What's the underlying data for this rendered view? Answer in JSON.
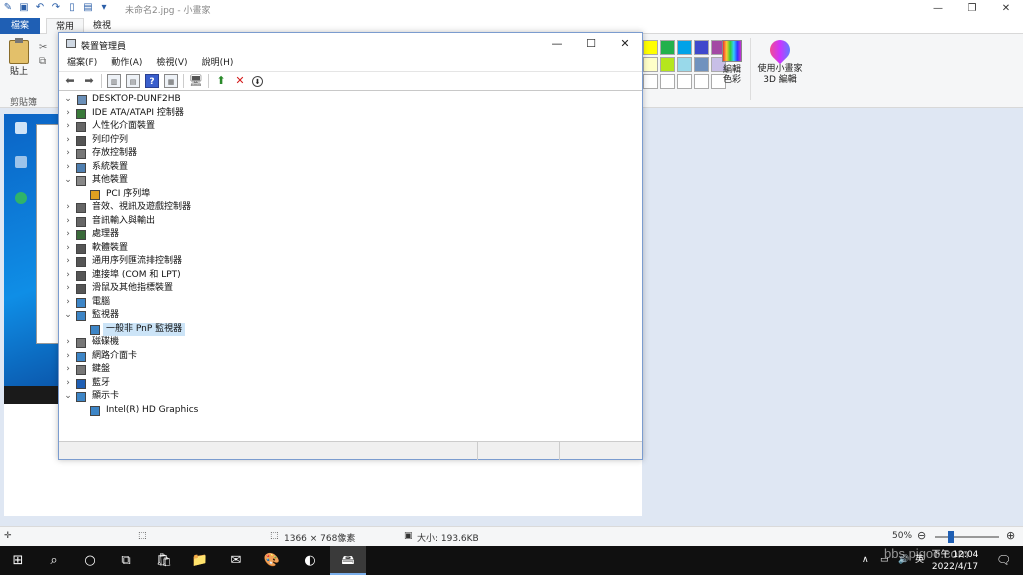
{
  "paint": {
    "title": "未命名2.jpg - 小畫家",
    "tabs": {
      "file": "檔案",
      "home": "常用",
      "view": "檢視"
    },
    "ribbon": {
      "paste_label": "貼上",
      "clipboard_group": "剪貼簿",
      "edit_colors": "編輯色彩",
      "paint3d": "使用小畫家 3D 編輯",
      "palette": [
        "#ffff00",
        "#22b14c",
        "#00a2e8",
        "#3f48cc",
        "#a349a4",
        "#ffffc8",
        "#b5e61d",
        "#99d9ea",
        "#7092be",
        "#c8bfe7",
        "#ffffff",
        "#ffffff",
        "#ffffff",
        "#ffffff",
        "#ffffff"
      ]
    },
    "status": {
      "dimensions": "1366 × 768像素",
      "size": "大小: 193.6KB",
      "zoom": "50%"
    }
  },
  "device_manager": {
    "title": "裝置管理員",
    "menu": [
      "檔案(F)",
      "動作(A)",
      "檢視(V)",
      "說明(H)"
    ],
    "root": "DESKTOP-DUNF2HB",
    "tree": [
      {
        "label": "IDE ATA/ATAPI 控制器",
        "level": 1,
        "expanded": false,
        "icon": "ide-icon",
        "color": "#3a7a3a"
      },
      {
        "label": "人性化介面裝置",
        "level": 1,
        "expanded": false,
        "icon": "hid-icon",
        "color": "#666666"
      },
      {
        "label": "列印佇列",
        "level": 1,
        "expanded": false,
        "icon": "printer-icon",
        "color": "#555555"
      },
      {
        "label": "存放控制器",
        "level": 1,
        "expanded": false,
        "icon": "storage-icon",
        "color": "#777777"
      },
      {
        "label": "系統裝置",
        "level": 1,
        "expanded": false,
        "icon": "system-icon",
        "color": "#4f7fb0"
      },
      {
        "label": "其他裝置",
        "level": 1,
        "expanded": true,
        "icon": "other-devices-icon",
        "color": "#888888"
      },
      {
        "label": "PCI 序列埠",
        "level": 2,
        "expanded": null,
        "icon": "warning-device-icon",
        "color": "#e0a020"
      },
      {
        "label": "音效、視訊及遊戲控制器",
        "level": 1,
        "expanded": false,
        "icon": "speaker-icon",
        "color": "#666666"
      },
      {
        "label": "音訊輸入與輸出",
        "level": 1,
        "expanded": false,
        "icon": "audio-icon",
        "color": "#666666"
      },
      {
        "label": "處理器",
        "level": 1,
        "expanded": false,
        "icon": "processor-icon",
        "color": "#3a6a3a"
      },
      {
        "label": "軟體裝置",
        "level": 1,
        "expanded": false,
        "icon": "software-icon",
        "color": "#555555"
      },
      {
        "label": "通用序列匯流排控制器",
        "level": 1,
        "expanded": false,
        "icon": "usb-icon",
        "color": "#555555"
      },
      {
        "label": "連接埠 (COM 和 LPT)",
        "level": 1,
        "expanded": false,
        "icon": "port-icon",
        "color": "#555555"
      },
      {
        "label": "滑鼠及其他指標裝置",
        "level": 1,
        "expanded": false,
        "icon": "mouse-icon",
        "color": "#555555"
      },
      {
        "label": "電腦",
        "level": 1,
        "expanded": false,
        "icon": "computer-icon",
        "color": "#3d85c6"
      },
      {
        "label": "監視器",
        "level": 1,
        "expanded": true,
        "icon": "monitor-icon",
        "color": "#3d85c6"
      },
      {
        "label": "一般非 PnP 監視器",
        "level": 2,
        "expanded": null,
        "icon": "monitor-icon",
        "color": "#3d85c6",
        "selected": true
      },
      {
        "label": "磁碟機",
        "level": 1,
        "expanded": false,
        "icon": "disk-icon",
        "color": "#777777"
      },
      {
        "label": "網路介面卡",
        "level": 1,
        "expanded": false,
        "icon": "network-icon",
        "color": "#3d85c6"
      },
      {
        "label": "鍵盤",
        "level": 1,
        "expanded": false,
        "icon": "keyboard-icon",
        "color": "#777777"
      },
      {
        "label": "藍牙",
        "level": 1,
        "expanded": false,
        "icon": "bluetooth-icon",
        "color": "#1f5fb4"
      },
      {
        "label": "顯示卡",
        "level": 1,
        "expanded": true,
        "icon": "display-adapter-icon",
        "color": "#3d85c6"
      },
      {
        "label": "Intel(R) HD Graphics",
        "level": 2,
        "expanded": null,
        "icon": "display-adapter-icon",
        "color": "#3d85c6"
      }
    ]
  },
  "taskbar": {
    "tray_lang": "英",
    "clock_time": "下午 12:04",
    "clock_date": "2022/4/17",
    "watermark": "bbs.pigoo.com"
  }
}
